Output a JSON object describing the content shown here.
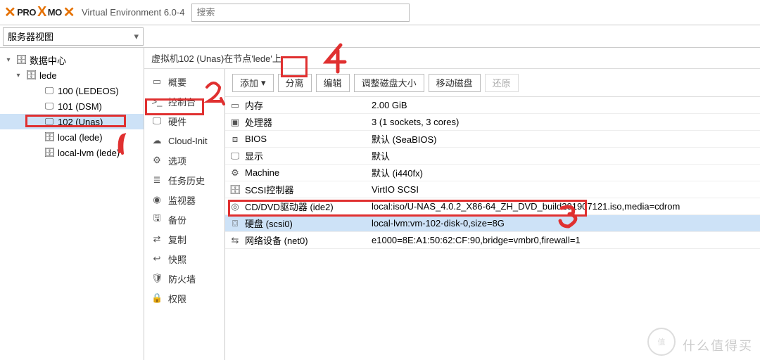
{
  "header": {
    "brand_pre": "PRO",
    "brand_mid": "X",
    "brand_post": "MO",
    "env_label": "Virtual Environment 6.0-4",
    "search_placeholder": "搜索"
  },
  "toolbar": {
    "view_label": "服务器视图"
  },
  "tree": {
    "root": {
      "label": "数据中心"
    },
    "node": {
      "label": "lede"
    },
    "children": [
      {
        "id": "100",
        "label": "100 (LEDEOS)",
        "icon": "🖵",
        "green": true
      },
      {
        "id": "101",
        "label": "101 (DSM)",
        "icon": "🖵",
        "green": false
      },
      {
        "id": "102",
        "label": "102 (Unas)",
        "icon": "🖵",
        "green": false,
        "selected": true
      },
      {
        "id": "local",
        "label": "local (lede)",
        "icon": "🗄",
        "green": false
      },
      {
        "id": "local-lvm",
        "label": "local-lvm (lede)",
        "icon": "🗄",
        "green": false
      }
    ]
  },
  "breadcrumb": "虚拟机102 (Unas)在节点'lede'上",
  "vtabs": [
    {
      "icon": "▭",
      "label": "概要"
    },
    {
      "icon": ">_",
      "label": "控制台"
    },
    {
      "icon": "🖵",
      "label": "硬件",
      "selected": true
    },
    {
      "icon": "☁",
      "label": "Cloud-Init"
    },
    {
      "icon": "⚙",
      "label": "选项"
    },
    {
      "icon": "≣",
      "label": "任务历史"
    },
    {
      "icon": "◉",
      "label": "监视器"
    },
    {
      "icon": "🖫",
      "label": "备份"
    },
    {
      "icon": "⇄",
      "label": "复制"
    },
    {
      "icon": "↩",
      "label": "快照"
    },
    {
      "icon": "🛡",
      "label": "防火墙"
    },
    {
      "icon": "🔒",
      "label": "权限"
    }
  ],
  "buttons": {
    "add": "添加",
    "detach": "分离",
    "edit": "编辑",
    "resize": "调整磁盘大小",
    "move": "移动磁盘",
    "restore": "还原"
  },
  "hardware": [
    {
      "icon": "▭",
      "k": "内存",
      "v": "2.00 GiB"
    },
    {
      "icon": "▣",
      "k": "处理器",
      "v": "3 (1 sockets, 3 cores)"
    },
    {
      "icon": "⧈",
      "k": "BIOS",
      "v": "默认 (SeaBIOS)"
    },
    {
      "icon": "🖵",
      "k": "显示",
      "v": "默认"
    },
    {
      "icon": "⚙",
      "k": "Machine",
      "v": "默认 (i440fx)"
    },
    {
      "icon": "🗄",
      "k": "SCSI控制器",
      "v": "VirtIO SCSI"
    },
    {
      "icon": "◎",
      "k": "CD/DVD驱动器 (ide2)",
      "v": "local:iso/U-NAS_4.0.2_X86-64_ZH_DVD_build201907121.iso,media=cdrom"
    },
    {
      "icon": "⌼",
      "k": "硬盘 (scsi0)",
      "v": "local-lvm:vm-102-disk-0,size=8G",
      "selected": true
    },
    {
      "icon": "⇆",
      "k": "网络设备 (net0)",
      "v": "e1000=8E:A1:50:62:CF:90,bridge=vmbr0,firewall=1"
    }
  ],
  "annotations": {
    "n1": "1",
    "n2": "2",
    "n3": "3",
    "n4": "4"
  },
  "watermark": "什么值得买"
}
